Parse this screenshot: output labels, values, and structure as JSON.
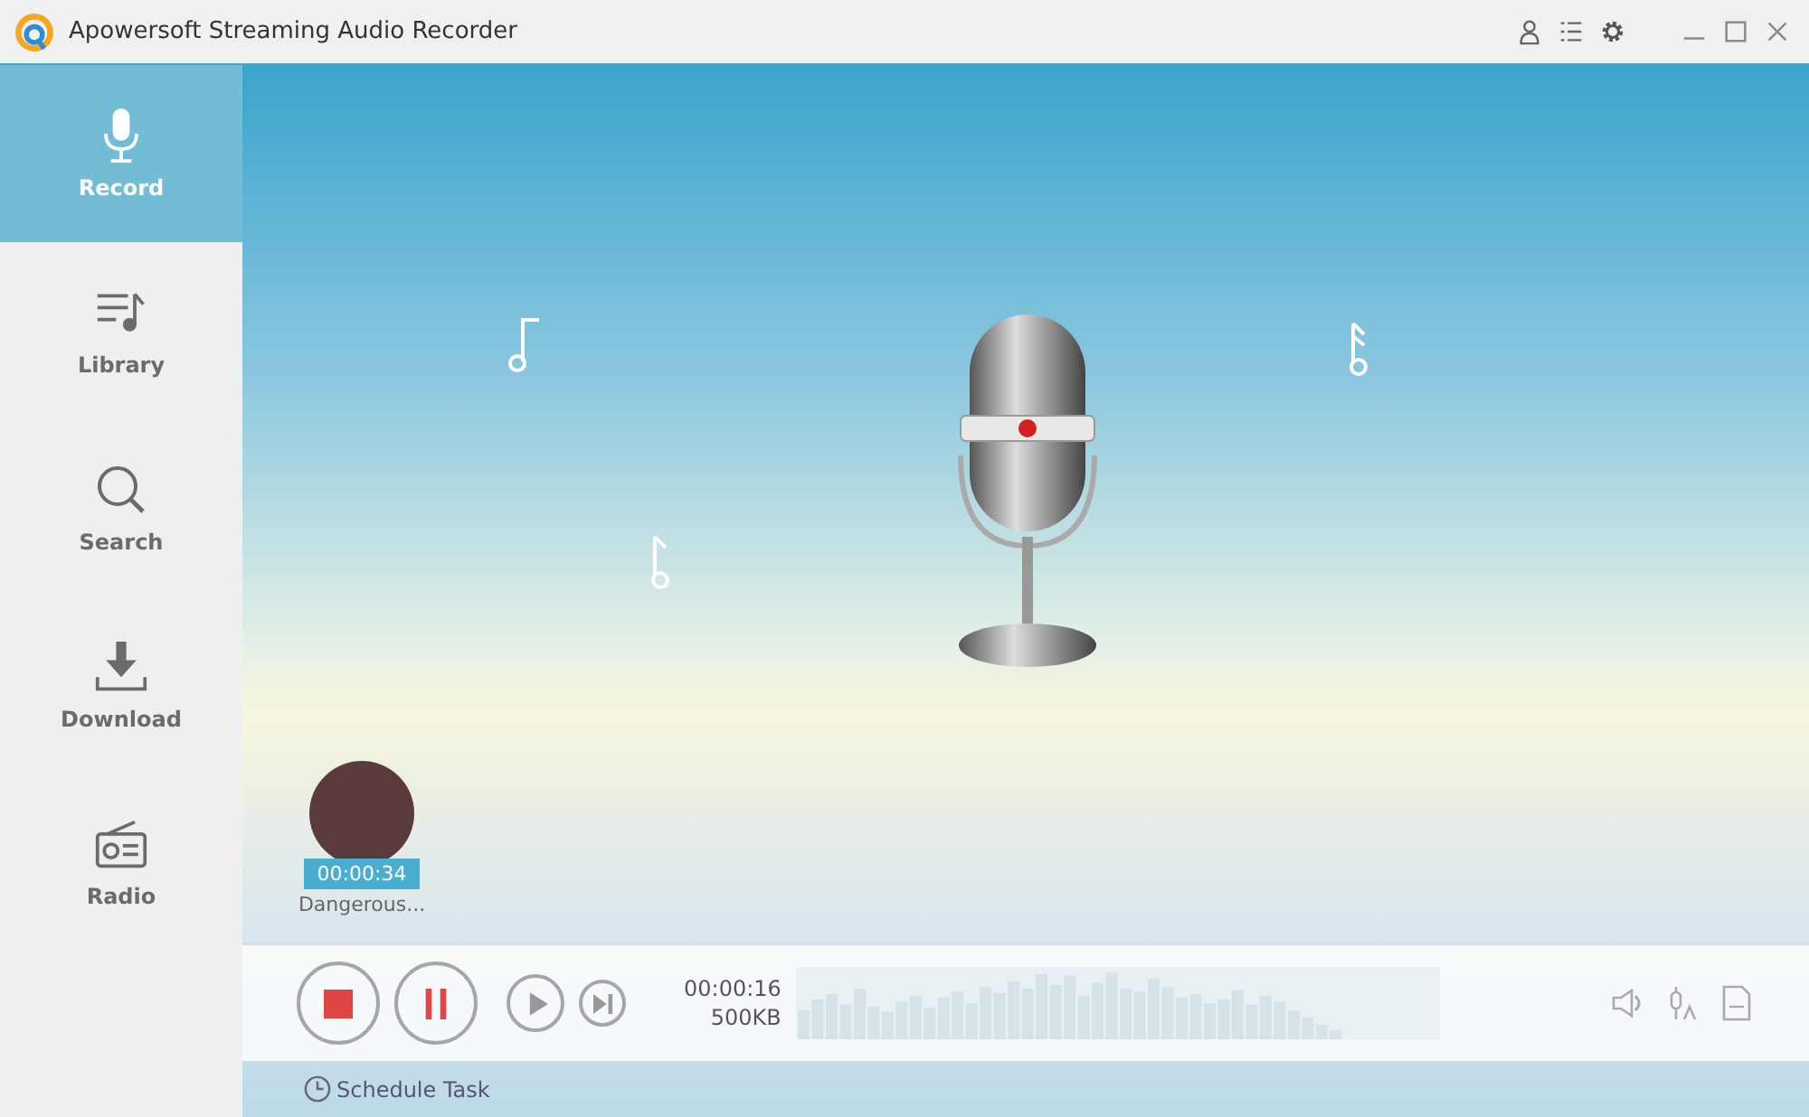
{
  "window": {
    "title": "Apowersoft Streaming Audio Recorder"
  },
  "sidebar": {
    "items": [
      {
        "label": "Record",
        "kind": "record",
        "selected": true
      },
      {
        "label": "Library",
        "kind": "library",
        "selected": false
      },
      {
        "label": "Search",
        "kind": "search",
        "selected": false
      },
      {
        "label": "Download",
        "kind": "download",
        "selected": false
      },
      {
        "label": "Radio",
        "kind": "radio",
        "selected": false
      }
    ]
  },
  "recent": {
    "duration": "00:00:34",
    "title": "Dangerous..."
  },
  "player": {
    "elapsed": "00:00:16",
    "size": "500KB"
  },
  "footer": {
    "schedule": "Schedule Task"
  }
}
